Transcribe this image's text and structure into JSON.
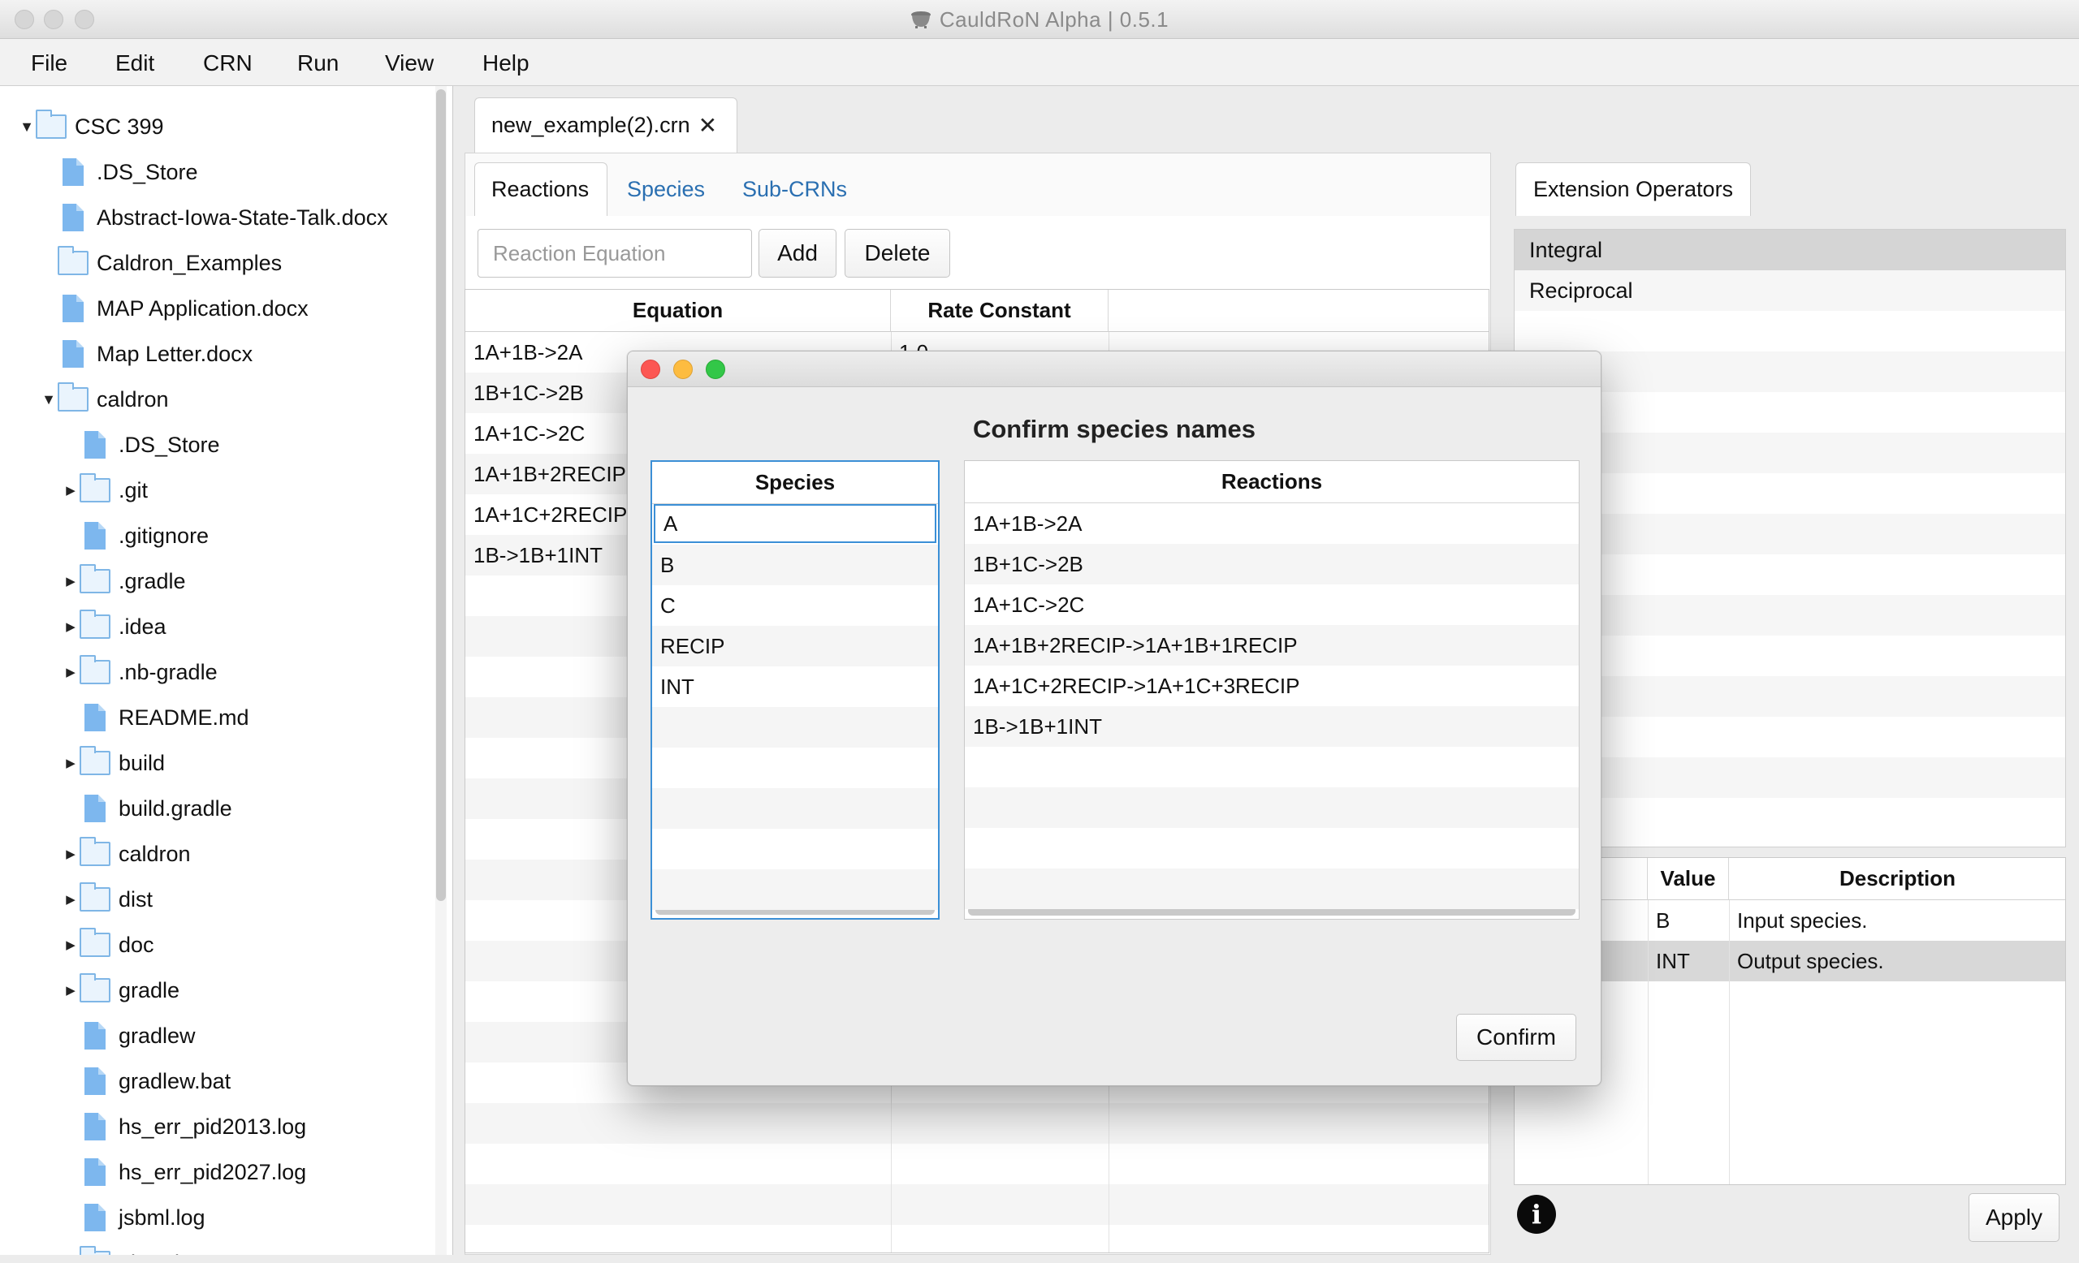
{
  "window": {
    "title": "CauldRoN Alpha | 0.5.1"
  },
  "menu": [
    "File",
    "Edit",
    "CRN",
    "Run",
    "View",
    "Help"
  ],
  "tree": [
    {
      "label": "CSC 399",
      "type": "folder",
      "level": 0,
      "arrow": "expanded"
    },
    {
      "label": ".DS_Store",
      "type": "file",
      "level": 1,
      "arrow": "none"
    },
    {
      "label": "Abstract-Iowa-State-Talk.docx",
      "type": "file",
      "level": 1,
      "arrow": "none"
    },
    {
      "label": "Caldron_Examples",
      "type": "folder",
      "level": 1,
      "arrow": "none"
    },
    {
      "label": "MAP Application.docx",
      "type": "file",
      "level": 1,
      "arrow": "none"
    },
    {
      "label": "Map Letter.docx",
      "type": "file",
      "level": 1,
      "arrow": "none"
    },
    {
      "label": "caldron",
      "type": "folder",
      "level": 1,
      "arrow": "expanded"
    },
    {
      "label": ".DS_Store",
      "type": "file",
      "level": 2,
      "arrow": "none"
    },
    {
      "label": ".git",
      "type": "folder",
      "level": 2,
      "arrow": "collapsed"
    },
    {
      "label": ".gitignore",
      "type": "file",
      "level": 2,
      "arrow": "none"
    },
    {
      "label": ".gradle",
      "type": "folder",
      "level": 2,
      "arrow": "collapsed"
    },
    {
      "label": ".idea",
      "type": "folder",
      "level": 2,
      "arrow": "collapsed"
    },
    {
      "label": ".nb-gradle",
      "type": "folder",
      "level": 2,
      "arrow": "collapsed"
    },
    {
      "label": "README.md",
      "type": "file",
      "level": 2,
      "arrow": "none"
    },
    {
      "label": "build",
      "type": "folder",
      "level": 2,
      "arrow": "collapsed"
    },
    {
      "label": "build.gradle",
      "type": "file",
      "level": 2,
      "arrow": "none"
    },
    {
      "label": "caldron",
      "type": "folder",
      "level": 2,
      "arrow": "collapsed"
    },
    {
      "label": "dist",
      "type": "folder",
      "level": 2,
      "arrow": "collapsed"
    },
    {
      "label": "doc",
      "type": "folder",
      "level": 2,
      "arrow": "collapsed"
    },
    {
      "label": "gradle",
      "type": "folder",
      "level": 2,
      "arrow": "collapsed"
    },
    {
      "label": "gradlew",
      "type": "file",
      "level": 2,
      "arrow": "none"
    },
    {
      "label": "gradlew.bat",
      "type": "file",
      "level": 2,
      "arrow": "none"
    },
    {
      "label": "hs_err_pid2013.log",
      "type": "file",
      "level": 2,
      "arrow": "none"
    },
    {
      "label": "hs_err_pid2027.log",
      "type": "file",
      "level": 2,
      "arrow": "none"
    },
    {
      "label": "jsbml.log",
      "type": "file",
      "level": 2,
      "arrow": "none"
    },
    {
      "label": "nbproject",
      "type": "folder",
      "level": 2,
      "arrow": "collapsed"
    }
  ],
  "doc_tab": {
    "label": "new_example(2).crn",
    "close": "✕"
  },
  "subtabs": {
    "reactions": "Reactions",
    "species": "Species",
    "sub_crns": "Sub-CRNs"
  },
  "toolbar": {
    "placeholder": "Reaction Equation",
    "add": "Add",
    "delete": "Delete"
  },
  "reactions_table": {
    "headers": [
      "Equation",
      "Rate Constant",
      ""
    ],
    "rows": [
      [
        "1A+1B->2A",
        "1.0"
      ],
      [
        "1B+1C->2B",
        ""
      ],
      [
        "1A+1C->2C",
        ""
      ],
      [
        "1A+1B+2RECIP-",
        ""
      ],
      [
        "1A+1C+2RECIP-",
        ""
      ],
      [
        "1B->1B+1INT",
        ""
      ]
    ]
  },
  "extension": {
    "tab": "Extension Operators",
    "items": [
      "Integral",
      "Reciprocal"
    ],
    "selected": "Integral"
  },
  "params_table": {
    "headers": [
      "e",
      "Value",
      "Description"
    ],
    "rows": [
      [
        "",
        "B",
        "Input species."
      ],
      [
        "",
        "INT",
        "Output species."
      ]
    ]
  },
  "apply_button": "Apply",
  "info_icon": "i",
  "dialog": {
    "title": "Confirm species names",
    "species_header": "Species",
    "species": [
      "A",
      "B",
      "C",
      "RECIP",
      "INT"
    ],
    "reactions_header": "Reactions",
    "reactions": [
      "1A+1B->2A",
      "1B+1C->2B",
      "1A+1C->2C",
      "1A+1B+2RECIP->1A+1B+1RECIP",
      "1A+1C+2RECIP->1A+1C+3RECIP",
      "1B->1B+1INT"
    ],
    "confirm": "Confirm"
  },
  "colors": {
    "link": "#2a6fb1",
    "selection_border": "#3b8fd6",
    "folder": "#7fb6e6",
    "file": "#7db7ee",
    "close_dot": "#fc5753",
    "min_dot": "#fdbc40",
    "max_dot": "#33c748"
  }
}
